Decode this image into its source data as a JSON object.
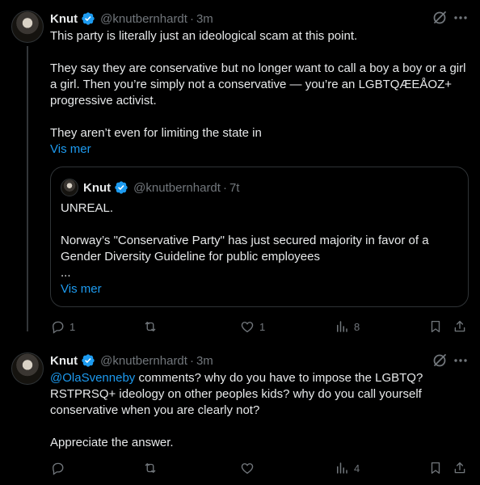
{
  "posts": [
    {
      "author": "Knut",
      "handle": "@knutbernhardt",
      "dot": "·",
      "time": "3m",
      "text": "This party is literally just an ideological scam at this point.\n\nThey say they are conservative but no longer want to call a boy a boy or a girl a girl. Then you’re simply not a conservative — you’re an LGBTQÆEÅOZ+ progressive activist.\n\nThey aren’t even for limiting the state in",
      "show_more": "Vis mer",
      "quote": {
        "author": "Knut",
        "handle": "@knutbernhardt",
        "dot": "·",
        "time": "7t",
        "text": "UNREAL.\n\nNorway’s \"Conservative Party\" has just secured majority in favor of a Gender Diversity Guideline for public employees\n...",
        "show_more": "Vis mer"
      },
      "actions": {
        "replies": "1",
        "reposts": "",
        "likes": "1",
        "views": "8"
      }
    },
    {
      "author": "Knut",
      "handle": "@knutbernhardt",
      "dot": "·",
      "time": "3m",
      "mention": "@OlaSvenneby",
      "text": " comments? why do you have to impose the LGBTQ?RSTPRSQ+ ideology on other peoples kids? why do you call yourself conservative when you are clearly not?\n\nAppreciate the answer.",
      "actions": {
        "replies": "",
        "reposts": "",
        "likes": "",
        "views": "4"
      }
    }
  ],
  "colors": {
    "background": "#000000",
    "text": "#e7e9ea",
    "muted": "#71767b",
    "accent": "#1d9bf0",
    "border": "#2f3336"
  },
  "icons": [
    "verified-badge-icon",
    "grok-icon",
    "more-icon",
    "reply-icon",
    "repost-icon",
    "like-icon",
    "views-icon",
    "bookmark-icon",
    "share-icon"
  ]
}
